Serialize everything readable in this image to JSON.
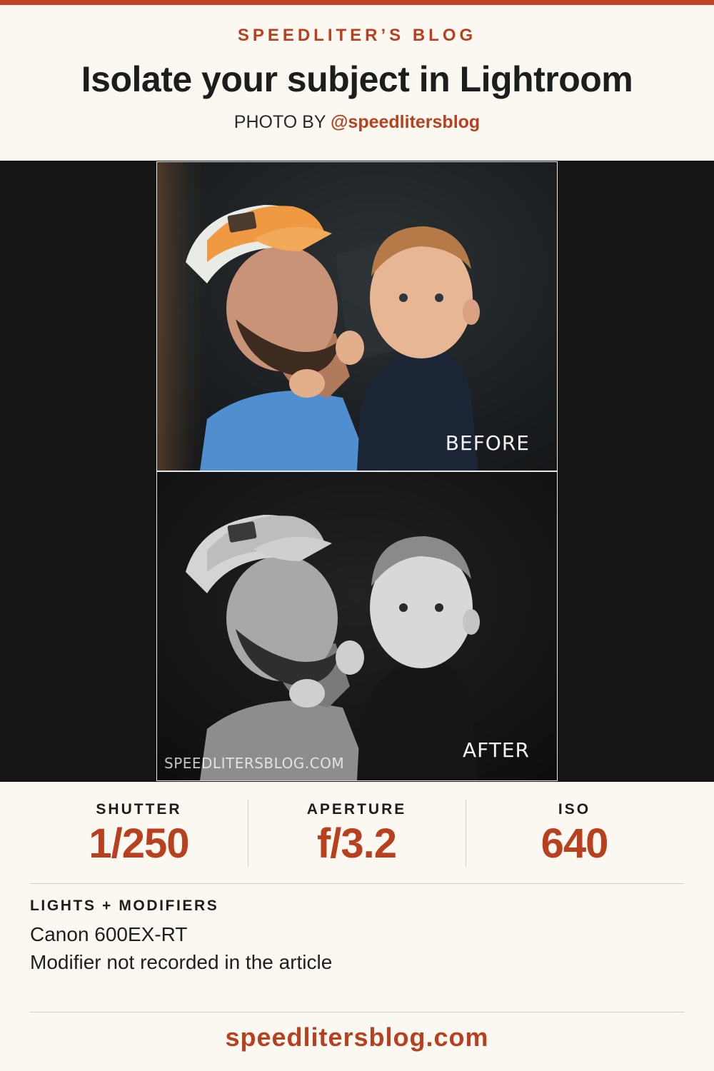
{
  "header": {
    "blog_name": "SPEEDLITER’S BLOG",
    "title": "Isolate your subject in Lightroom",
    "credit_prefix": "PHOTO BY",
    "credit_handle": "@speedlitersblog"
  },
  "photos": {
    "before_label": "BEFORE",
    "after_label": "AFTER",
    "watermark": "SPEEDLITERSBLOG.COM"
  },
  "settings": {
    "shutter_label": "SHUTTER",
    "shutter_value": "1/250",
    "aperture_label": "APERTURE",
    "aperture_value": "f/3.2",
    "iso_label": "ISO",
    "iso_value": "640"
  },
  "lights": {
    "heading": "LIGHTS + MODIFIERS",
    "items": [
      "Canon 600EX-RT",
      "Modifier not recorded in the article"
    ]
  },
  "footer": {
    "url": "speedlitersblog.com"
  },
  "colors": {
    "accent": "#b8401f",
    "background": "#fbf8f1",
    "photo_band": "#151515"
  }
}
